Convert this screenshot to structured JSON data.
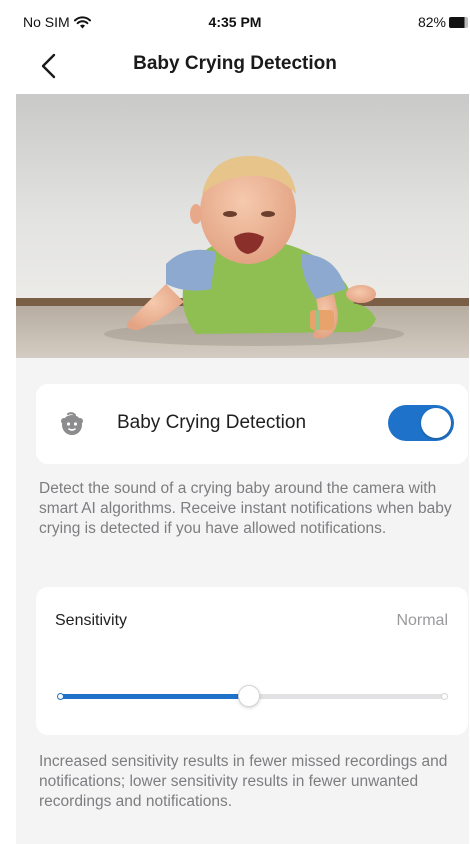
{
  "status_bar": {
    "carrier": "No SIM",
    "time": "4:35 PM",
    "battery": "82%",
    "battery_level": 0.82
  },
  "nav": {
    "title": "Baby Crying Detection"
  },
  "hero": {
    "icon": "baby-photo"
  },
  "detection": {
    "label": "Baby Crying Detection",
    "enabled": true,
    "description": "Detect the sound of a crying baby around the camera with smart AI algorithms. Receive instant notifications when baby crying is detected if you have allowed notifications."
  },
  "sensitivity": {
    "label": "Sensitivity",
    "value_label": "Normal",
    "level": 0.49,
    "note": "Increased sensitivity results in fewer missed recordings and notifications; lower sensitivity results in fewer unwanted recordings and notifications."
  },
  "colors": {
    "accent": "#1e72c9",
    "background": "#f4f4f5",
    "secondary_text": "#7d7d80"
  }
}
